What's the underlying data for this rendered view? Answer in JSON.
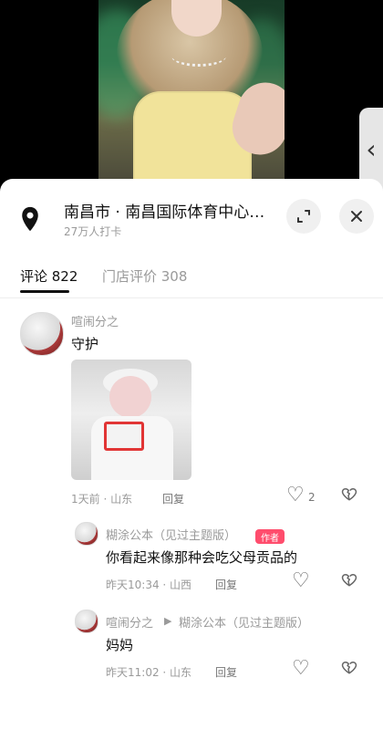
{
  "location": {
    "title": "南昌市 · 南昌国际体育中心…",
    "subtitle": "27万人打卡"
  },
  "tabs": [
    {
      "label": "评论 822",
      "active": true
    },
    {
      "label": "门店评价 308",
      "active": false
    }
  ],
  "comments": [
    {
      "author": "喧闹分之",
      "text": "守护",
      "meta": "1天前 · 山东",
      "reply_label": "回复",
      "like_count": "2",
      "icons": {
        "like": "heart-outline-icon",
        "dislike": "broken-heart-icon"
      }
    }
  ],
  "replies": [
    {
      "author": "糊涂公本（见过主题版）",
      "badge": "作者",
      "text": "你看起来像那种会吃父母贡品的",
      "meta": "昨天10:34 · 山西",
      "reply_label": "回复",
      "icons": {
        "like": "heart-outline-icon",
        "dislike": "broken-heart-icon"
      }
    },
    {
      "author": "喧闹分之",
      "reply_to": "糊涂公本（见过主题版）",
      "text": "妈妈",
      "meta": "昨天11:02 · 山东",
      "reply_label": "回复",
      "icons": {
        "like": "heart-outline-icon",
        "dislike": "broken-heart-icon"
      }
    }
  ],
  "ui": {
    "side_tab_icon": "chevron-left-icon",
    "expand_icon": "expand-icon",
    "close_icon": "close-icon",
    "location_icon": "location-pin-icon"
  }
}
